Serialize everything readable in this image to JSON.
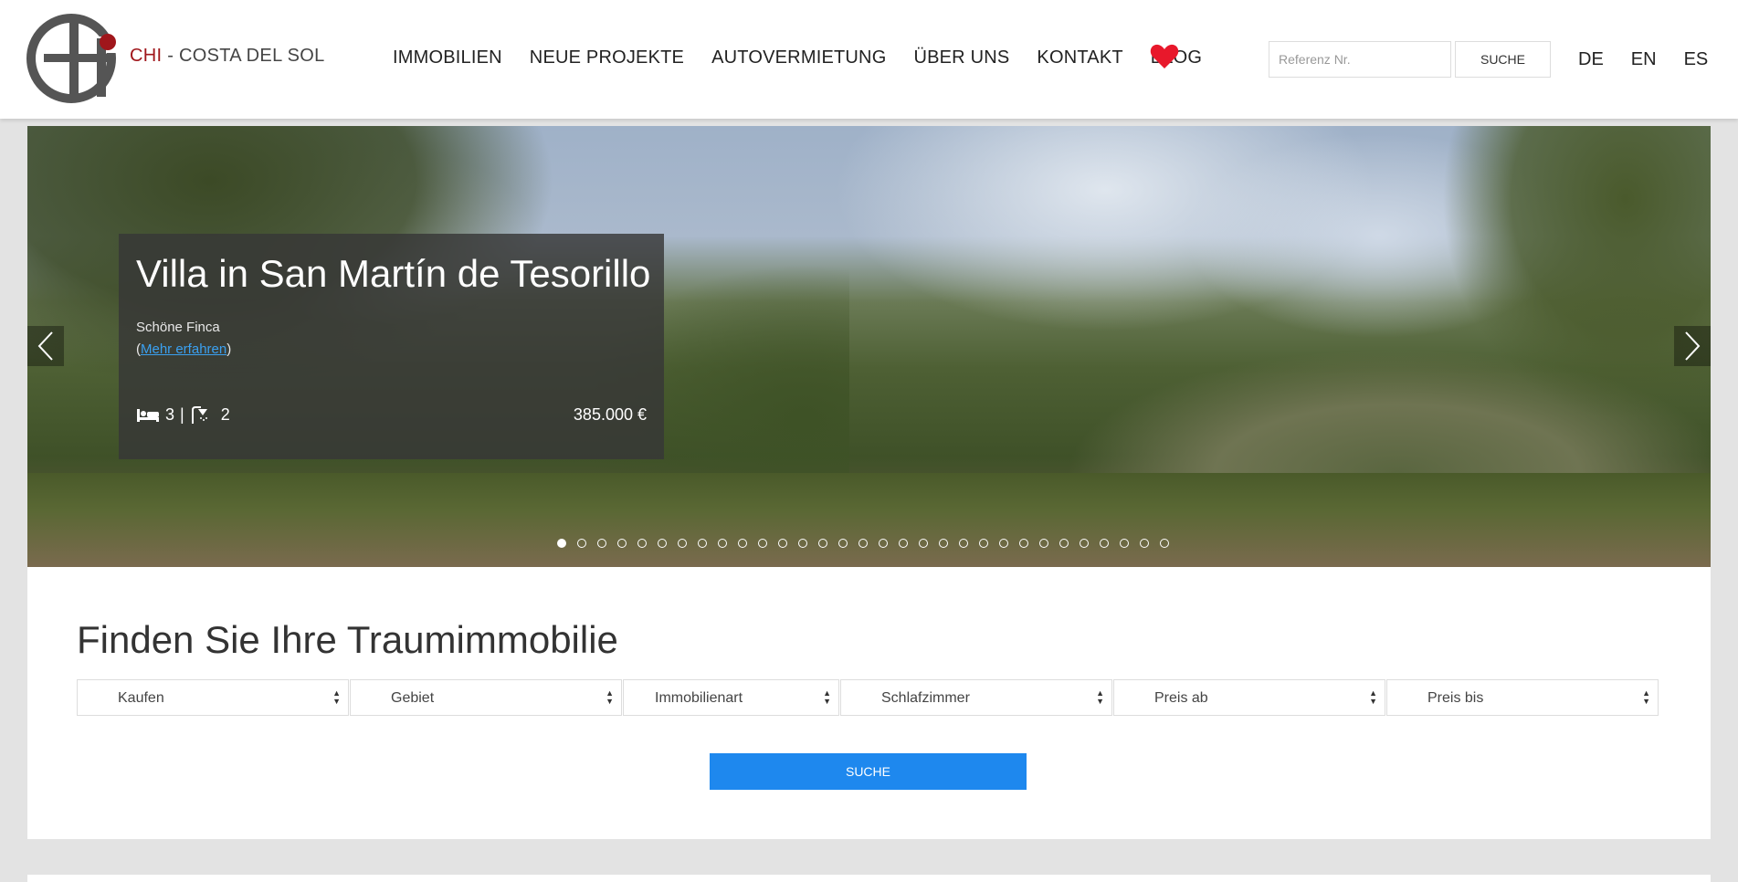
{
  "header": {
    "logo_text_red": "CHI",
    "logo_text_rest": " - COSTA DEL SOL",
    "nav": [
      "IMMOBILIEN",
      "NEUE PROJEKTE",
      "AUTOVERMIETUNG",
      "ÜBER UNS",
      "KONTAKT",
      "BLOG"
    ],
    "ref_placeholder": "Referenz Nr.",
    "search_label": "SUCHE",
    "languages": [
      "DE",
      "EN",
      "ES"
    ],
    "colors": {
      "brand_red": "#a0161b",
      "heart": "#e8182b"
    }
  },
  "hero": {
    "title": "Villa in San Martín de Tesorillo",
    "subtitle": "Schöne Finca",
    "link_open": "(",
    "link_text": "Mehr erfahren",
    "link_close": ")",
    "bedrooms": "3",
    "separator": "|",
    "bathrooms": "2",
    "price": "385.000 €",
    "slide_count": 31,
    "active_slide": 1
  },
  "search": {
    "title": "Finden Sie Ihre Traumimmobilie",
    "filters": [
      "Kaufen",
      "Gebiet",
      "Immobilienart",
      "Schlafzimmer",
      "Preis ab",
      "Preis bis"
    ],
    "button_label": "SUCHE",
    "button_color": "#1e88ee"
  }
}
